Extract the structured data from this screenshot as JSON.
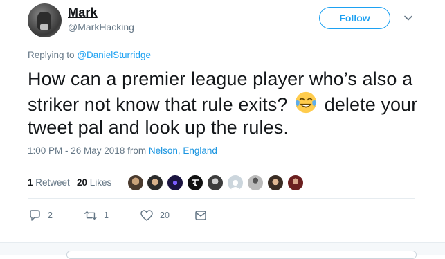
{
  "author": {
    "name": "Mark",
    "handle": "@MarkHacking",
    "avatar_icon": "user-avatar"
  },
  "follow_button": {
    "label": "Follow"
  },
  "more_menu": {
    "icon": "chevron-down-icon"
  },
  "reply": {
    "prefix": "Replying to",
    "mention": "@DanielSturridge"
  },
  "tweet": {
    "text_before_emoji": "How can a premier league player who’s also a striker not know that rule exits?",
    "emoji": "face-with-tears-of-joy",
    "text_after_emoji": "delete your tweet pal and look up the rules."
  },
  "meta": {
    "time_date": "1:00 PM - 26 May 2018",
    "from_label": "from",
    "location": "Nelson, England"
  },
  "stats": {
    "retweets_count": "1",
    "retweets_label": "Retweet",
    "likes_count": "20",
    "likes_label": "Likes"
  },
  "actions": {
    "reply_count": "2",
    "retweet_count": "1",
    "like_count": "20"
  },
  "colors": {
    "accent": "#1da1f2",
    "muted": "#657786",
    "text": "#14171a",
    "divider": "#e6ecf0"
  }
}
